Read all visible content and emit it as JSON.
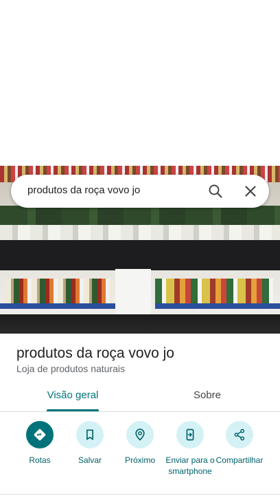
{
  "search": {
    "query": "produtos da roça vovo jo"
  },
  "place": {
    "name": "produtos da roça vovo jo",
    "category": "Loja de produtos naturais"
  },
  "tabs": [
    {
      "label": "Visão geral",
      "selected": true
    },
    {
      "label": "Sobre",
      "selected": false
    }
  ],
  "actions": [
    {
      "label": "Rotas",
      "icon": "directions-icon"
    },
    {
      "label": "Salvar",
      "icon": "bookmark-icon"
    },
    {
      "label": "Próximo",
      "icon": "nearby-icon"
    },
    {
      "label": "Enviar para o smartphone",
      "icon": "send-to-phone-icon"
    },
    {
      "label": "Compartilhar",
      "icon": "share-icon"
    }
  ],
  "colors": {
    "accent": "#00737a",
    "action_bg": "#d4f2f5"
  }
}
